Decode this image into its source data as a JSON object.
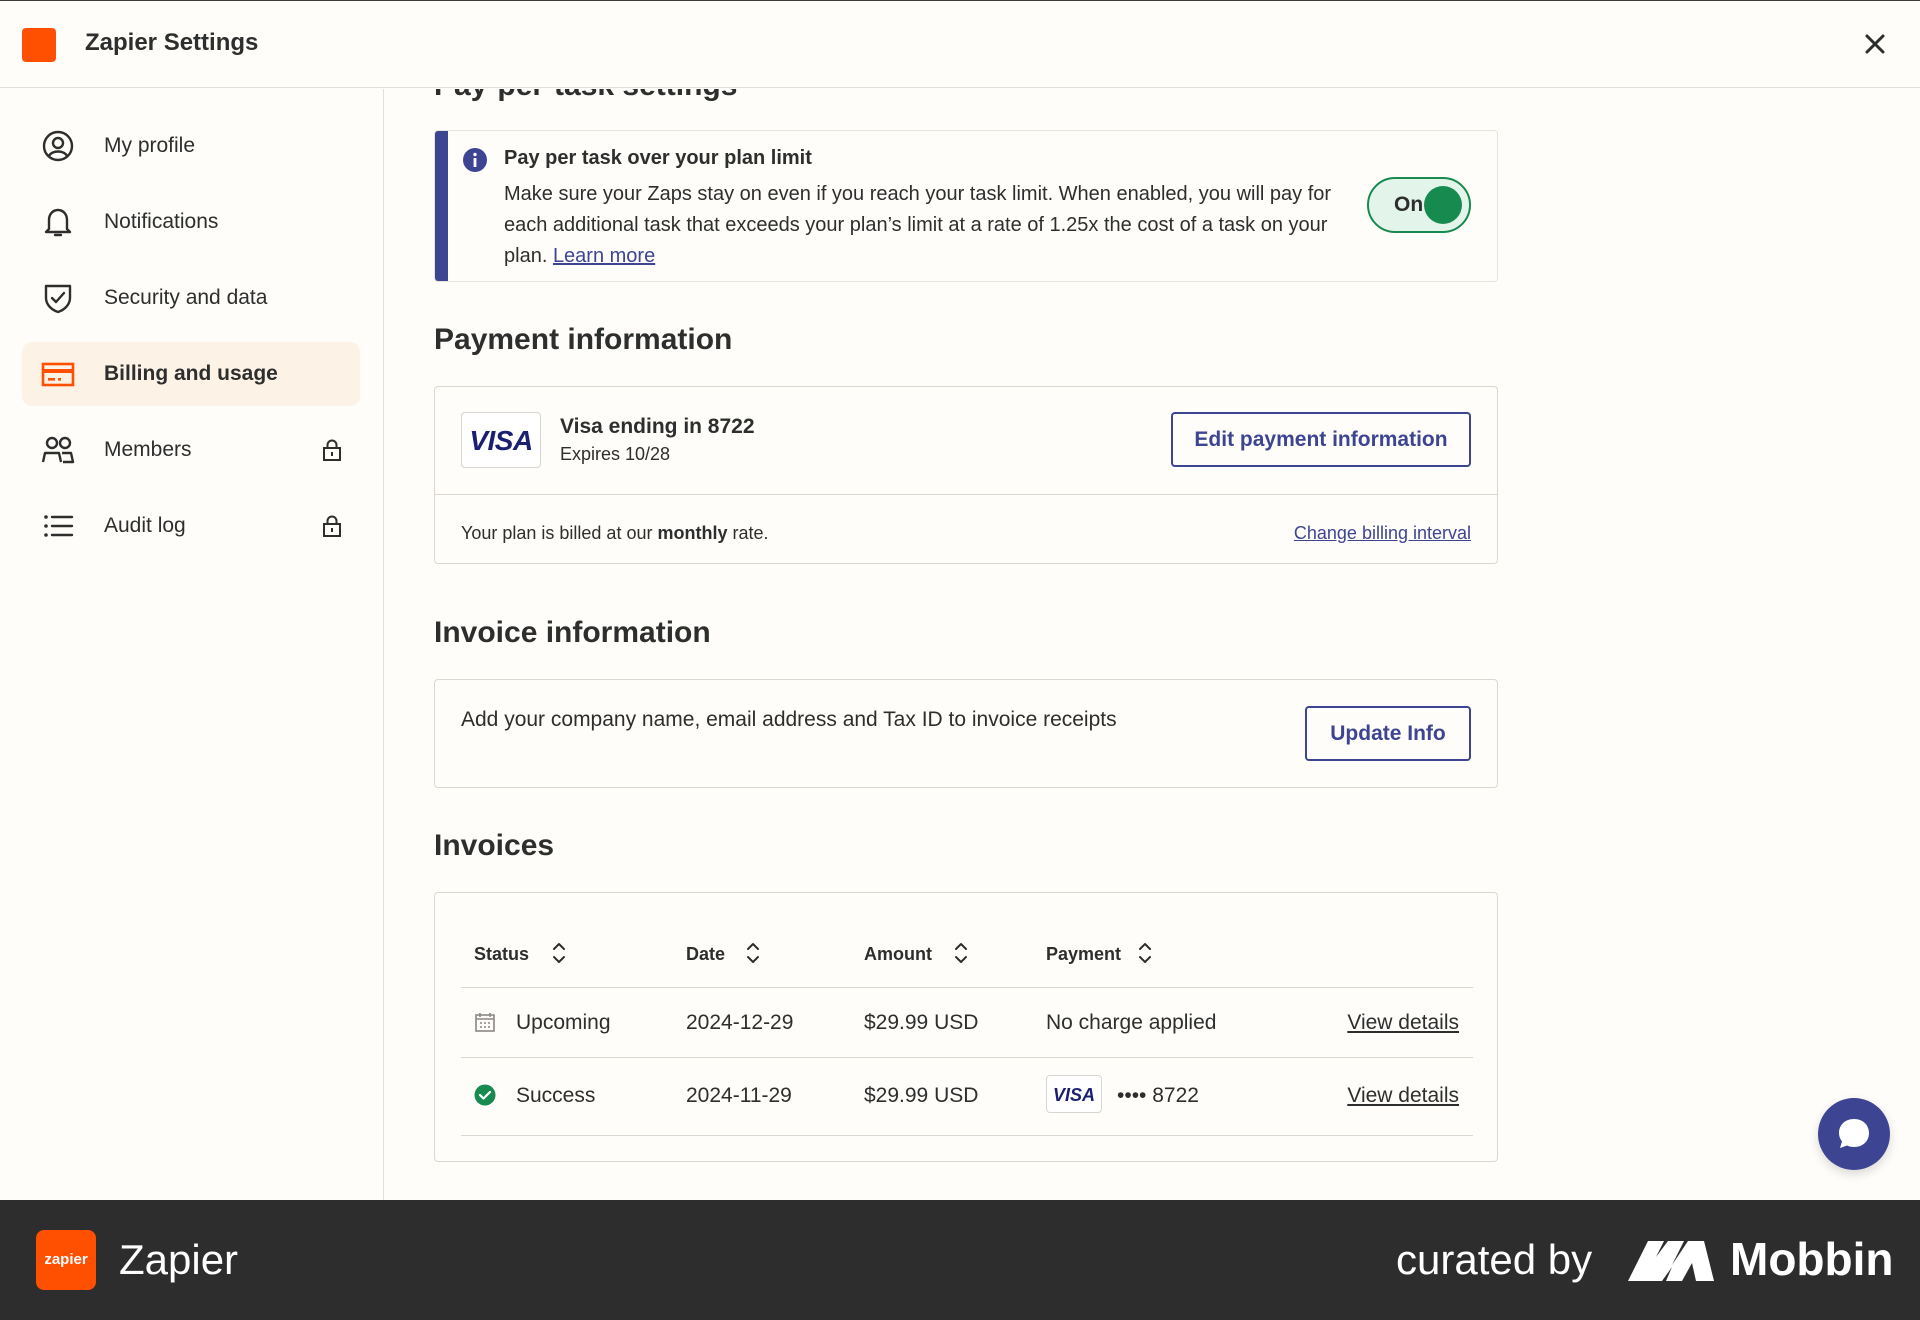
{
  "header": {
    "title": "Zapier Settings",
    "close_icon": "close-icon"
  },
  "sidebar": {
    "items": [
      {
        "label": "My profile",
        "icon": "user-circle-icon",
        "locked": false,
        "active": false
      },
      {
        "label": "Notifications",
        "icon": "bell-icon",
        "locked": false,
        "active": false
      },
      {
        "label": "Security and data",
        "icon": "shield-check-icon",
        "locked": false,
        "active": false
      },
      {
        "label": "Billing and usage",
        "icon": "credit-card-icon",
        "locked": false,
        "active": true
      },
      {
        "label": "Members",
        "icon": "users-icon",
        "locked": true,
        "active": false
      },
      {
        "label": "Audit log",
        "icon": "list-icon",
        "locked": true,
        "active": false
      }
    ]
  },
  "pay_per_task": {
    "partial_heading": "Pay-per-task settings",
    "alert_title": "Pay per task over your plan limit",
    "alert_body": "Make sure your Zaps stay on even if you reach your task limit. When enabled, you will pay for each additional task that exceeds your plan’s limit at a rate of 1.25x the cost of a task on your plan.",
    "learn_more": "Learn more",
    "toggle_label": "On",
    "toggle_state": true
  },
  "payment": {
    "title": "Payment information",
    "card_brand": "VISA",
    "card_name": "Visa ending in 8722",
    "expires": "Expires 10/28",
    "edit_button": "Edit payment information",
    "billed_prefix": "Your plan is billed at our ",
    "billed_interval": "monthly",
    "billed_suffix": " rate.",
    "change_link": "Change billing interval"
  },
  "invoice_info": {
    "title": "Invoice information",
    "description": "Add your company name, email address and Tax ID to invoice receipts",
    "update_button": "Update Info"
  },
  "invoices": {
    "title": "Invoices",
    "columns": [
      "Status",
      "Date",
      "Amount",
      "Payment"
    ],
    "rows": [
      {
        "status": "Upcoming",
        "status_icon": "calendar-icon",
        "date": "2024-12-29",
        "amount": "$29.99 USD",
        "payment": "No charge applied",
        "action": "View details"
      },
      {
        "status": "Success",
        "status_icon": "check-circle-icon",
        "date": "2024-11-29",
        "amount": "$29.99 USD",
        "payment_brand": "VISA",
        "payment": "•••• 8722",
        "action": "View details"
      }
    ]
  },
  "footer": {
    "logo_text": "zapier",
    "app_name": "Zapier",
    "curated_by": "curated by",
    "brand": "Mobbin"
  },
  "colors": {
    "brand_orange": "#ff4f00",
    "accent_navy": "#3d4592",
    "toggle_green": "#168a4f",
    "active_bg": "#fdf2e6",
    "footer_bg": "#2d2d2d"
  }
}
